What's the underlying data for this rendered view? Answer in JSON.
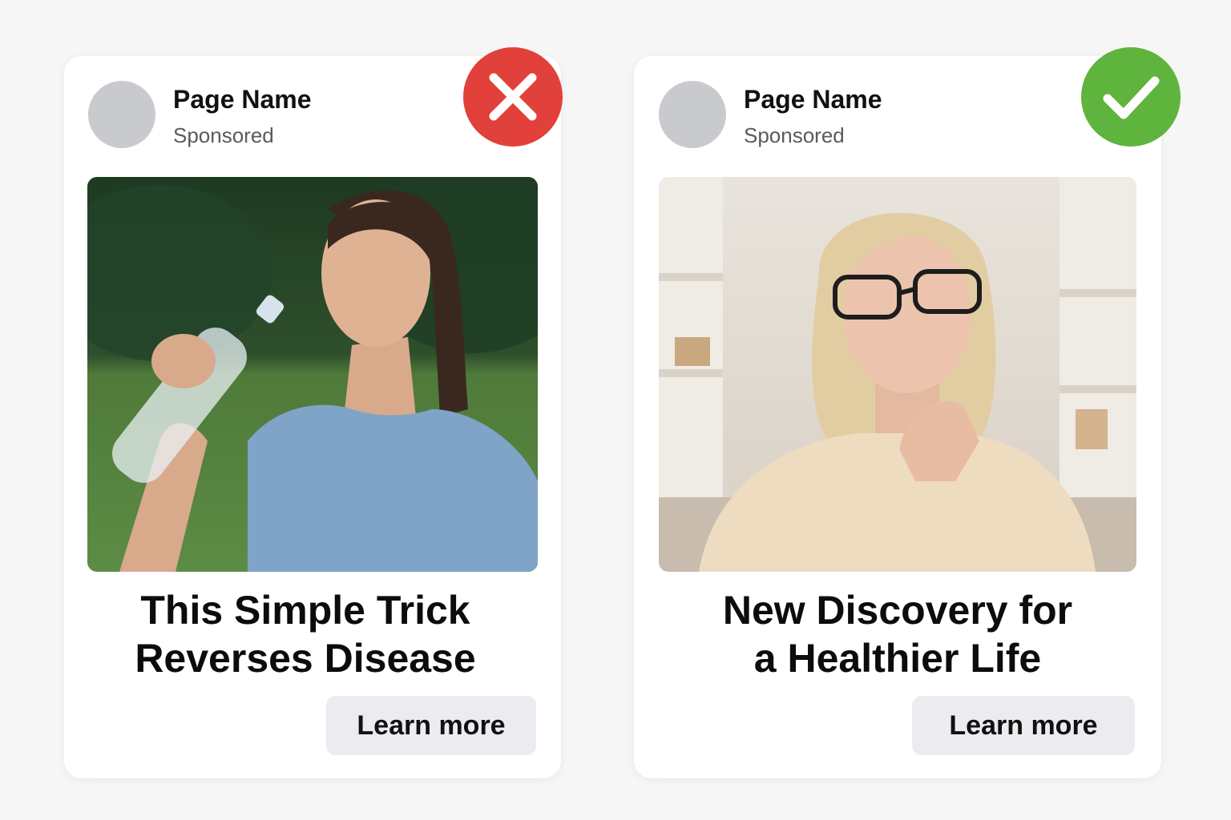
{
  "colors": {
    "background": "#f6f6f6",
    "card": "#ffffff",
    "bad_badge": "#e2403a",
    "good_badge": "#5eb43d",
    "button_bg": "#ebebf0",
    "avatar": "#c9cacd"
  },
  "ads": [
    {
      "page_name": "Page Name",
      "sponsored_label": "Sponsored",
      "image_description_icon": "woman-drinking-water-photo",
      "headline_line1": "This Simple Trick",
      "headline_line2": "Reverses Disease",
      "cta_label": "Learn more",
      "verdict_icon": "x-icon"
    },
    {
      "page_name": "Page Name",
      "sponsored_label": "Sponsored",
      "image_description_icon": "thoughtful-woman-photo",
      "headline_line1": "New Discovery for",
      "headline_line2": "a Healthier Life",
      "cta_label": "Learn more",
      "verdict_icon": "check-icon"
    }
  ]
}
